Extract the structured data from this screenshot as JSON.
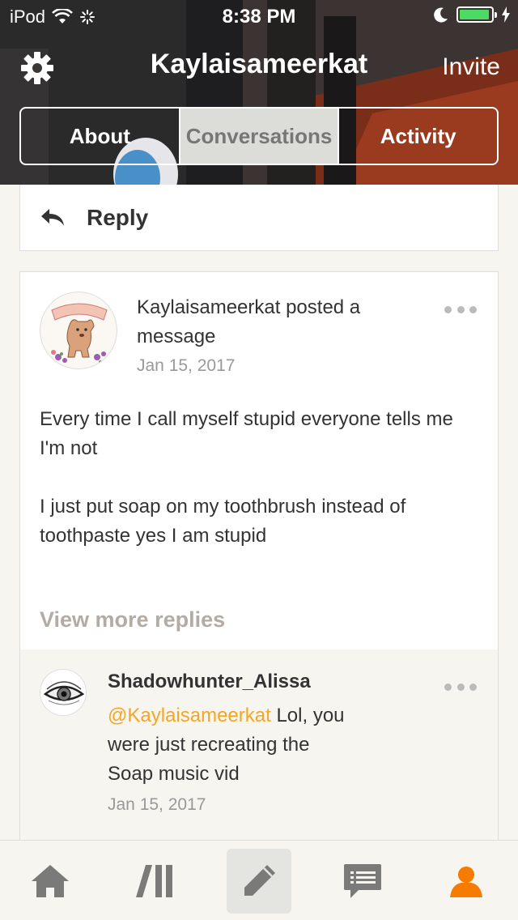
{
  "status": {
    "carrier": "iPod",
    "time": "8:38 PM"
  },
  "header": {
    "title": "Kaylaisameerkat",
    "invite_label": "Invite",
    "tabs": [
      {
        "label": "About",
        "active": false
      },
      {
        "label": "Conversations",
        "active": true
      },
      {
        "label": "Activity",
        "active": false
      }
    ]
  },
  "reply_bar": {
    "label": "Reply"
  },
  "post": {
    "header_text": "Kaylaisameerkat posted a message",
    "date": "Jan 15, 2017",
    "body": [
      "Every time I call myself stupid everyone tells me I'm not",
      "I just put soap on my toothbrush instead of toothpaste yes I am stupid"
    ],
    "view_more_label": "View more replies"
  },
  "reply": {
    "author": "Shadowhunter_Alissa",
    "mention": "@Kaylaisameerkat",
    "text": " Lol, you were just recreating the Soap music vid",
    "date": "Jan 15, 2017"
  },
  "nav": {
    "items": [
      "home-icon",
      "catalog-icon",
      "compose-icon",
      "chat-icon",
      "profile-icon"
    ],
    "active": "profile-icon",
    "accent_color": "#f57c00",
    "muted_color": "#7a7a78"
  },
  "colors": {
    "mention": "#f5a623",
    "battery": "#4cd964"
  }
}
